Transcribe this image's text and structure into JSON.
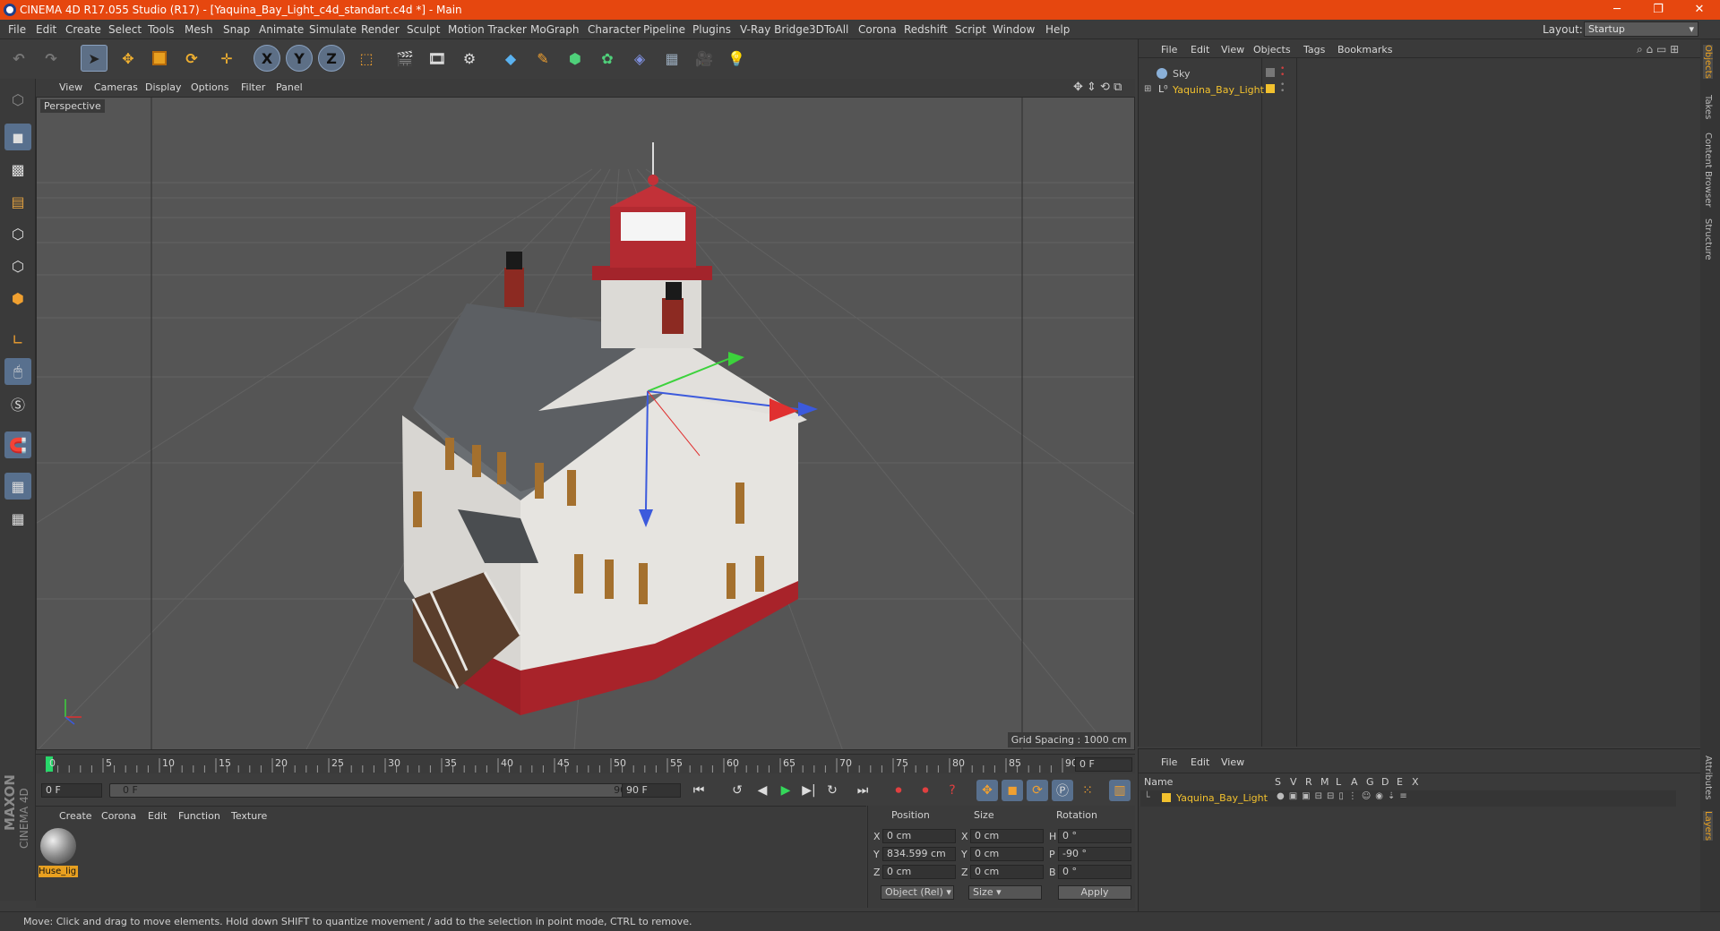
{
  "window": {
    "title": "CINEMA 4D R17.055 Studio (R17) - [Yaquina_Bay_Light_c4d_standart.c4d *] - Main",
    "min": "─",
    "max": "❐",
    "close": "✕"
  },
  "menu": [
    "File",
    "Edit",
    "Create",
    "Select",
    "Tools",
    "Mesh",
    "Snap",
    "Animate",
    "Simulate",
    "Render",
    "Sculpt",
    "Motion Tracker",
    "MoGraph",
    "Character",
    "Pipeline",
    "Plugins",
    "V-Ray Bridge",
    "3DToAll",
    "Corona",
    "Redshift",
    "Script",
    "Window",
    "Help"
  ],
  "layout": {
    "label": "Layout:",
    "value": "Startup"
  },
  "toolbar": {
    "x": "X",
    "y": "Y",
    "z": "Z"
  },
  "viewport": {
    "menu": [
      "View",
      "Cameras",
      "Display",
      "Options",
      "Filter",
      "Panel"
    ],
    "label": "Perspective",
    "grid_spacing": "Grid Spacing : 1000 cm"
  },
  "timeline": {
    "ticks": [
      "0",
      "5",
      "10",
      "15",
      "20",
      "25",
      "30",
      "35",
      "40",
      "45",
      "50",
      "55",
      "60",
      "65",
      "70",
      "75",
      "80",
      "85",
      "90"
    ],
    "end_field": "0 F"
  },
  "transport": {
    "start": "0 F",
    "range_start": "0 F",
    "range_end": "90 F",
    "end": "90 F"
  },
  "materials": {
    "menu": [
      "Create",
      "Corona",
      "Edit",
      "Function",
      "Texture"
    ],
    "item": "Huse_lig"
  },
  "coords": {
    "headers": [
      "Position",
      "Size",
      "Rotation"
    ],
    "rows": [
      {
        "a": "X",
        "pos": "0 cm",
        "b": "X",
        "size": "0 cm",
        "c": "H",
        "rot": "0 °"
      },
      {
        "a": "Y",
        "pos": "834.599 cm",
        "b": "Y",
        "size": "0 cm",
        "c": "P",
        "rot": "-90 °"
      },
      {
        "a": "Z",
        "pos": "0 cm",
        "b": "Z",
        "size": "0 cm",
        "c": "B",
        "rot": "0 °"
      }
    ],
    "mode": "Object (Rel)",
    "size_mode": "Size",
    "apply": "Apply"
  },
  "objects": {
    "menu": [
      "File",
      "Edit",
      "View",
      "Objects",
      "Tags",
      "Bookmarks"
    ],
    "items": [
      {
        "name": "Sky"
      },
      {
        "name": "Yaquina_Bay_Light"
      }
    ]
  },
  "layers": {
    "menu": [
      "File",
      "Edit",
      "View"
    ],
    "name_header": "Name",
    "cols": [
      "S",
      "V",
      "R",
      "M",
      "L",
      "A",
      "G",
      "D",
      "E",
      "X"
    ],
    "item": "Yaquina_Bay_Light"
  },
  "right_tabs": [
    "Objects",
    "Takes",
    "Content Browser",
    "Structure",
    "Attributes",
    "Layers"
  ],
  "status": "Move: Click and drag to move elements. Hold down SHIFT to quantize movement / add to the selection in point mode, CTRL to remove.",
  "brand": {
    "line1": "MAXON",
    "line2": "CINEMA 4D"
  },
  "colors": {
    "title_bar": "#e6470f",
    "selected_object": "#f2c12e"
  }
}
